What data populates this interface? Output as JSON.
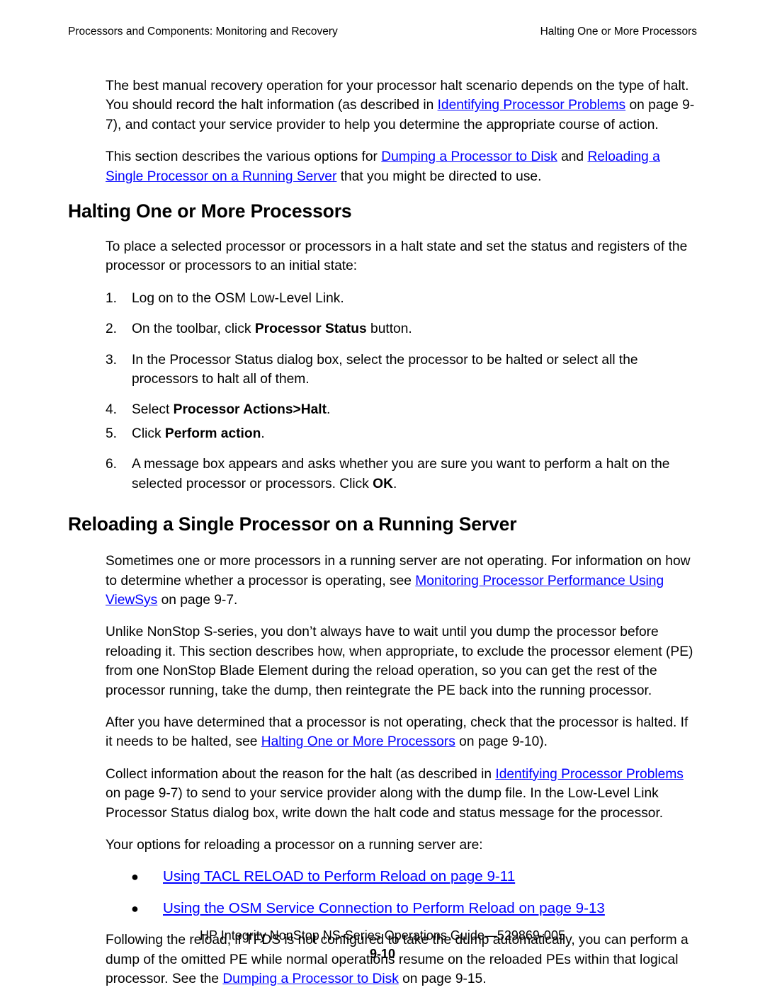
{
  "header": {
    "left": "Processors and Components: Monitoring and Recovery",
    "right": "Halting One or More Processors"
  },
  "intro": {
    "p1_a": "The best manual recovery operation for your processor halt scenario depends on the type of halt. You should record the halt information (as described in ",
    "p1_link": "Identifying Processor Problems",
    "p1_b": " on page 9-7), and contact your service provider to help you determine the appropriate course of action.",
    "p2_a": "This section describes the various options for ",
    "p2_link1": "Dumping a Processor to Disk",
    "p2_mid": " and ",
    "p2_link2": "Reloading a Single Processor on a Running Server",
    "p2_b": " that you might be directed to use."
  },
  "section_halting": {
    "heading": "Halting One or More Processors",
    "lead": "To place a selected processor or processors in a halt state and set the status and registers of the processor or processors to an initial state:",
    "steps": [
      {
        "num": "1.",
        "a": "Log on to the OSM Low-Level Link.",
        "bold": "",
        "b": ""
      },
      {
        "num": "2.",
        "a": "On the toolbar, click ",
        "bold": "Processor Status",
        "b": " button."
      },
      {
        "num": "3.",
        "a": "In the Processor Status dialog box, select the processor to be halted or select all the processors to halt all of them.",
        "bold": "",
        "b": ""
      },
      {
        "num": "4.",
        "a": "Select ",
        "bold": "Processor Actions>Halt",
        "b": "."
      },
      {
        "num": "5.",
        "a": "Click ",
        "bold": "Perform action",
        "b": "."
      },
      {
        "num": "6.",
        "a": "A message box appears and asks whether you are sure you want to perform a halt on the selected processor or processors. Click ",
        "bold": "OK",
        "b": "."
      }
    ]
  },
  "section_reloading": {
    "heading": "Reloading a Single Processor on a Running Server",
    "p1_a": "Sometimes one or more processors in a running server are not operating. For information on how to determine whether a processor is operating, see ",
    "p1_link": "Monitoring Processor Performance Using ViewSys",
    "p1_b": " on page 9-7.",
    "p2": "Unlike NonStop S-series, you don’t always have to wait until you dump the processor before reloading it. This section describes how, when appropriate, to exclude the processor element (PE) from one NonStop Blade Element during the reload operation, so you can get the rest of the processor running, take the dump, then reintegrate the PE back into the running processor.",
    "p3_a": "After you have determined that a processor is not operating, check that the processor is halted. If it needs to be halted, see ",
    "p3_link": "Halting One or More Processors",
    "p3_b": " on page 9-10).",
    "p4_a": "Collect information about the reason for the halt (as described in ",
    "p4_link": "Identifying Processor Problems",
    "p4_b": " on page 9-7) to send to your service provider along with the dump file. In the Low-Level Link Processor Status dialog box, write down the halt code and status message for the processor.",
    "options_lead": "Your options for reloading a processor on a running server are:",
    "options": [
      {
        "bullet": "●",
        "link": "Using TACL RELOAD to Perform Reload on page 9-11"
      },
      {
        "bullet": "●",
        "link": "Using the OSM Service Connection to Perform Reload on page 9-13"
      }
    ],
    "p5_a": "Following the reload, if TFDS is not configured to take the dump automatically, you can perform a dump of the omitted PE while normal operations resume on the reloaded PEs within that logical processor. See the ",
    "p5_link": "Dumping a Processor to Disk",
    "p5_b": " on page 9-15."
  },
  "footer": {
    "line": "HP Integrity NonStop NS-Series Operations Guide—529869-005",
    "page": "9-10"
  },
  "colors": {
    "link": "#0000ff",
    "text": "#000000",
    "background": "#ffffff"
  }
}
